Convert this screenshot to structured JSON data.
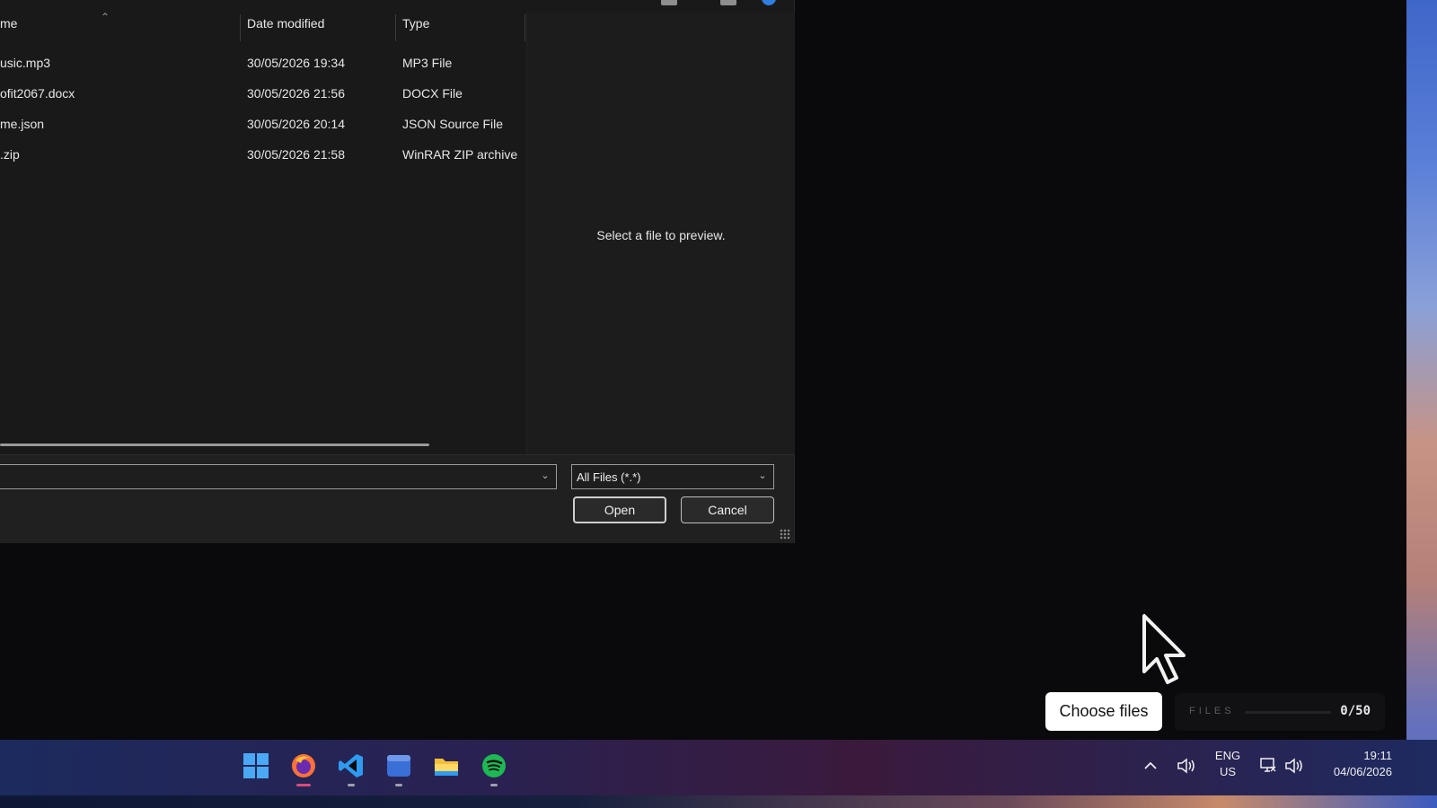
{
  "dialog": {
    "columns": {
      "name": "me",
      "date_modified": "Date modified",
      "type": "Type"
    },
    "files": [
      {
        "name": "usic.mp3",
        "date": "30/05/2026 19:34",
        "type": "MP3 File"
      },
      {
        "name": "ofit2067.docx",
        "date": "30/05/2026 21:56",
        "type": "DOCX File"
      },
      {
        "name": "me.json",
        "date": "30/05/2026 20:14",
        "type": "JSON Source File"
      },
      {
        "name": ".zip",
        "date": "30/05/2026 21:58",
        "type": "WinRAR ZIP archive"
      }
    ],
    "preview_text": "Select a file to preview.",
    "file_name_value": "",
    "filter_value": "All Files (*.*)",
    "open_label": "Open",
    "cancel_label": "Cancel"
  },
  "upload": {
    "choose_label": "Choose files",
    "files_label": "FILES",
    "files_count": "0/50",
    "progress": 0
  },
  "taskbar": {
    "apps": [
      "start-icon",
      "firefox-icon",
      "vscode-icon",
      "app-window-icon",
      "file-explorer-icon",
      "spotify-icon"
    ],
    "language": "ENG",
    "region": "US",
    "time": "19:11",
    "date": "04/06/2026"
  },
  "colors": {
    "accent_blue": "#2f7de0",
    "spotify_green": "#1db954",
    "firefox_orange": "#ff7139",
    "vscode_blue": "#2f9bf0",
    "folder_yellow": "#f3c03a"
  }
}
